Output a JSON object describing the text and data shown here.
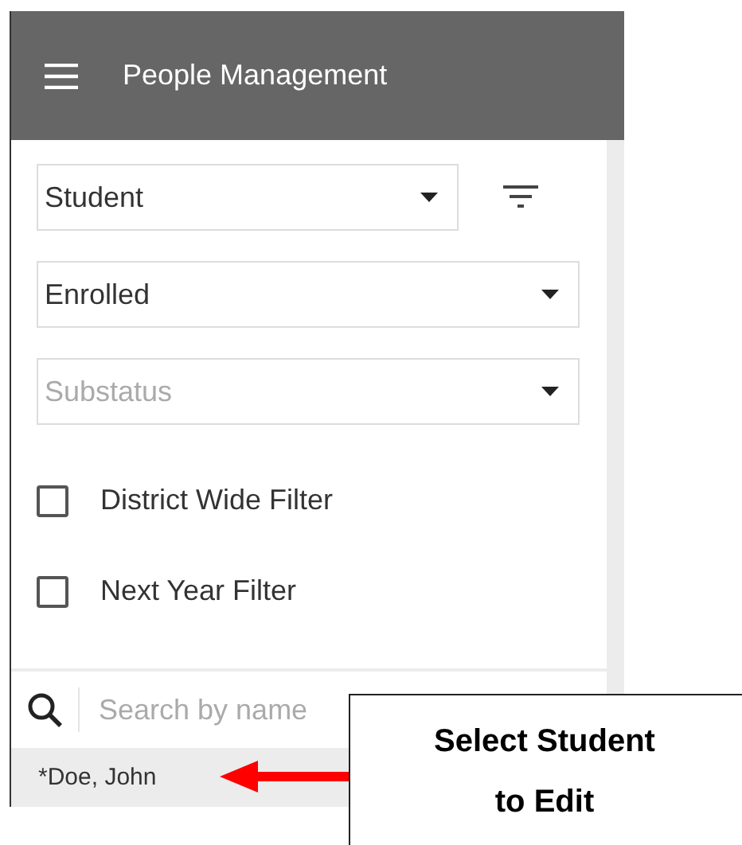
{
  "header": {
    "title": "People Management"
  },
  "selects": [
    {
      "value": "Student"
    },
    {
      "value": "Enrolled"
    },
    {
      "placeholder": "Substatus"
    }
  ],
  "checkboxes": [
    {
      "label": "District Wide Filter",
      "checked": false
    },
    {
      "label": "Next Year Filter",
      "checked": false
    }
  ],
  "search": {
    "placeholder": "Search by name"
  },
  "results": [
    "*Doe, John"
  ],
  "callout": {
    "text": "Select Student to Edit"
  }
}
